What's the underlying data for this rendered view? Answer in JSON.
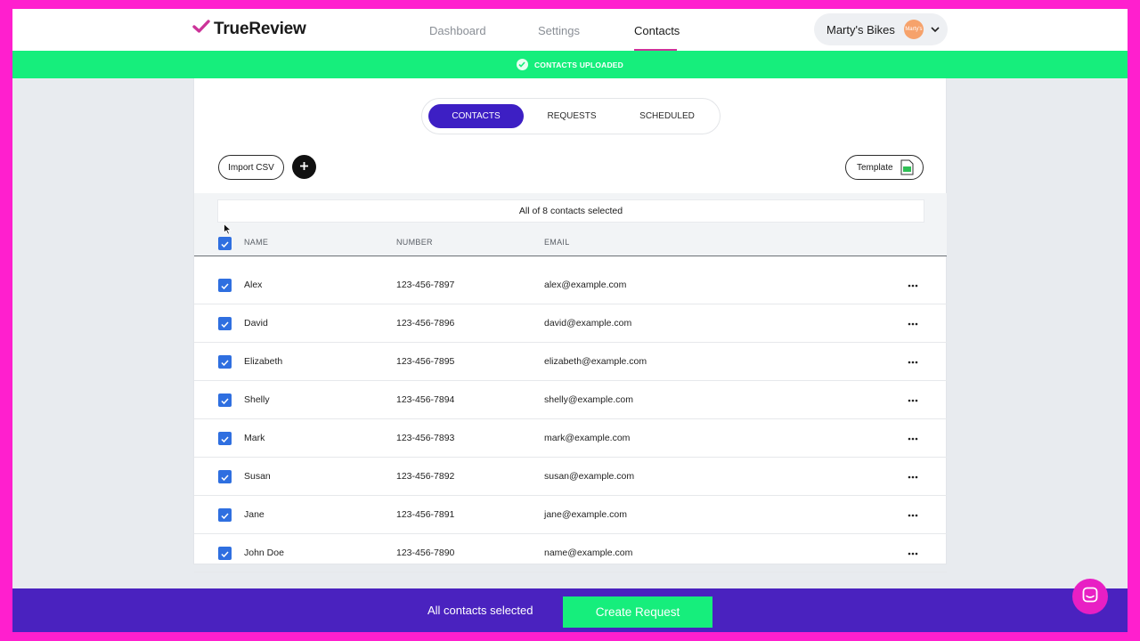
{
  "header": {
    "brand": "TrueReview",
    "nav": [
      {
        "label": "Dashboard"
      },
      {
        "label": "Settings"
      },
      {
        "label": "Contacts"
      }
    ],
    "account_name": "Marty's Bikes",
    "avatar_text": "Marty's"
  },
  "banner": {
    "text": "CONTACTS UPLOADED",
    "color": "#16ee7c"
  },
  "tabs": [
    {
      "label": "CONTACTS"
    },
    {
      "label": "REQUESTS"
    },
    {
      "label": "SCHEDULED"
    }
  ],
  "toolbar": {
    "import_label": "Import CSV",
    "template_label": "Template"
  },
  "table": {
    "selection_text": "All of 8 contacts selected",
    "columns": [
      "NAME",
      "NUMBER",
      "EMAIL"
    ],
    "rows": [
      {
        "name": "Alex",
        "number": "123-456-7897",
        "email": "alex@example.com"
      },
      {
        "name": "David",
        "number": "123-456-7896",
        "email": "david@example.com"
      },
      {
        "name": "Elizabeth",
        "number": "123-456-7895",
        "email": "elizabeth@example.com"
      },
      {
        "name": "Shelly",
        "number": "123-456-7894",
        "email": "shelly@example.com"
      },
      {
        "name": "Mark",
        "number": "123-456-7893",
        "email": "mark@example.com"
      },
      {
        "name": "Susan",
        "number": "123-456-7892",
        "email": "susan@example.com"
      },
      {
        "name": "Jane",
        "number": "123-456-7891",
        "email": "jane@example.com"
      },
      {
        "name": "John Doe",
        "number": "123-456-7890",
        "email": "name@example.com"
      }
    ]
  },
  "footer": {
    "status": "All contacts selected",
    "button_label": "Create Request"
  },
  "colors": {
    "accent": "#3d1fc4",
    "brand_pink": "#cc3399",
    "success": "#16ee7c",
    "bottom_bar": "#4a22bf",
    "checkbox": "#2f6fe0"
  },
  "icons": [
    "check-logo-icon",
    "chevron-down-icon",
    "check-circle-icon",
    "plus-icon",
    "csv-file-icon",
    "more-horizontal-icon",
    "chat-icon"
  ]
}
